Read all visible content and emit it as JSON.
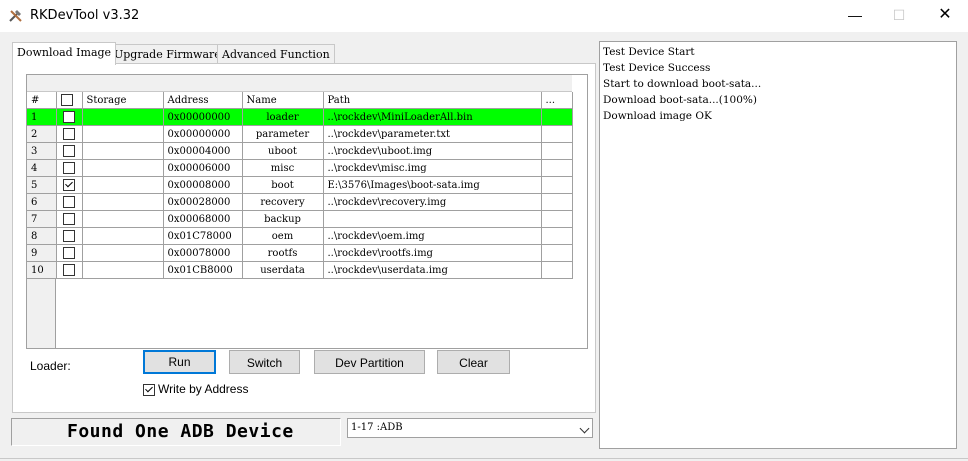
{
  "window": {
    "title": "RKDevTool v3.32",
    "minimize": "—",
    "maximize": "☐",
    "close": "✕"
  },
  "tabs": [
    {
      "label": "Download Image",
      "active": true
    },
    {
      "label": "Upgrade Firmware",
      "active": false
    },
    {
      "label": "Advanced Function",
      "active": false
    }
  ],
  "table": {
    "columns": [
      "#",
      "",
      "Storage",
      "Address",
      "Name",
      "Path",
      "..."
    ],
    "rows": [
      {
        "num": "1",
        "checked": false,
        "storage": "",
        "address": "0x00000000",
        "name": "loader",
        "path": "..\\rockdev\\MiniLoaderAll.bin",
        "highlight": true
      },
      {
        "num": "2",
        "checked": false,
        "storage": "",
        "address": "0x00000000",
        "name": "parameter",
        "path": "..\\rockdev\\parameter.txt"
      },
      {
        "num": "3",
        "checked": false,
        "storage": "",
        "address": "0x00004000",
        "name": "uboot",
        "path": "..\\rockdev\\uboot.img"
      },
      {
        "num": "4",
        "checked": false,
        "storage": "",
        "address": "0x00006000",
        "name": "misc",
        "path": "..\\rockdev\\misc.img"
      },
      {
        "num": "5",
        "checked": true,
        "storage": "",
        "address": "0x00008000",
        "name": "boot",
        "path": "E:\\3576\\Images\\boot-sata.img"
      },
      {
        "num": "6",
        "checked": false,
        "storage": "",
        "address": "0x00028000",
        "name": "recovery",
        "path": "..\\rockdev\\recovery.img"
      },
      {
        "num": "7",
        "checked": false,
        "storage": "",
        "address": "0x00068000",
        "name": "backup",
        "path": ""
      },
      {
        "num": "8",
        "checked": false,
        "storage": "",
        "address": "0x01C78000",
        "name": "oem",
        "path": "..\\rockdev\\oem.img"
      },
      {
        "num": "9",
        "checked": false,
        "storage": "",
        "address": "0x00078000",
        "name": "rootfs",
        "path": "..\\rockdev\\rootfs.img"
      },
      {
        "num": "10",
        "checked": false,
        "storage": "",
        "address": "0x01CB8000",
        "name": "userdata",
        "path": "..\\rockdev\\userdata.img"
      }
    ]
  },
  "loader_label": "Loader:",
  "buttons": {
    "run": "Run",
    "switch": "Switch",
    "dev_partition": "Dev Partition",
    "clear": "Clear"
  },
  "write_by_address": {
    "label": "Write by Address",
    "checked": true
  },
  "status_text": "Found One ADB Device",
  "device_select": {
    "value": "1-17 :ADB"
  },
  "log_lines": [
    "Test Device Start",
    "Test Device Success",
    "Start to download boot-sata...",
    "Download boot-sata...(100%)",
    "Download image OK"
  ],
  "colors": {
    "highlight_row": "#00ff00",
    "focus_border": "#0078d7"
  }
}
